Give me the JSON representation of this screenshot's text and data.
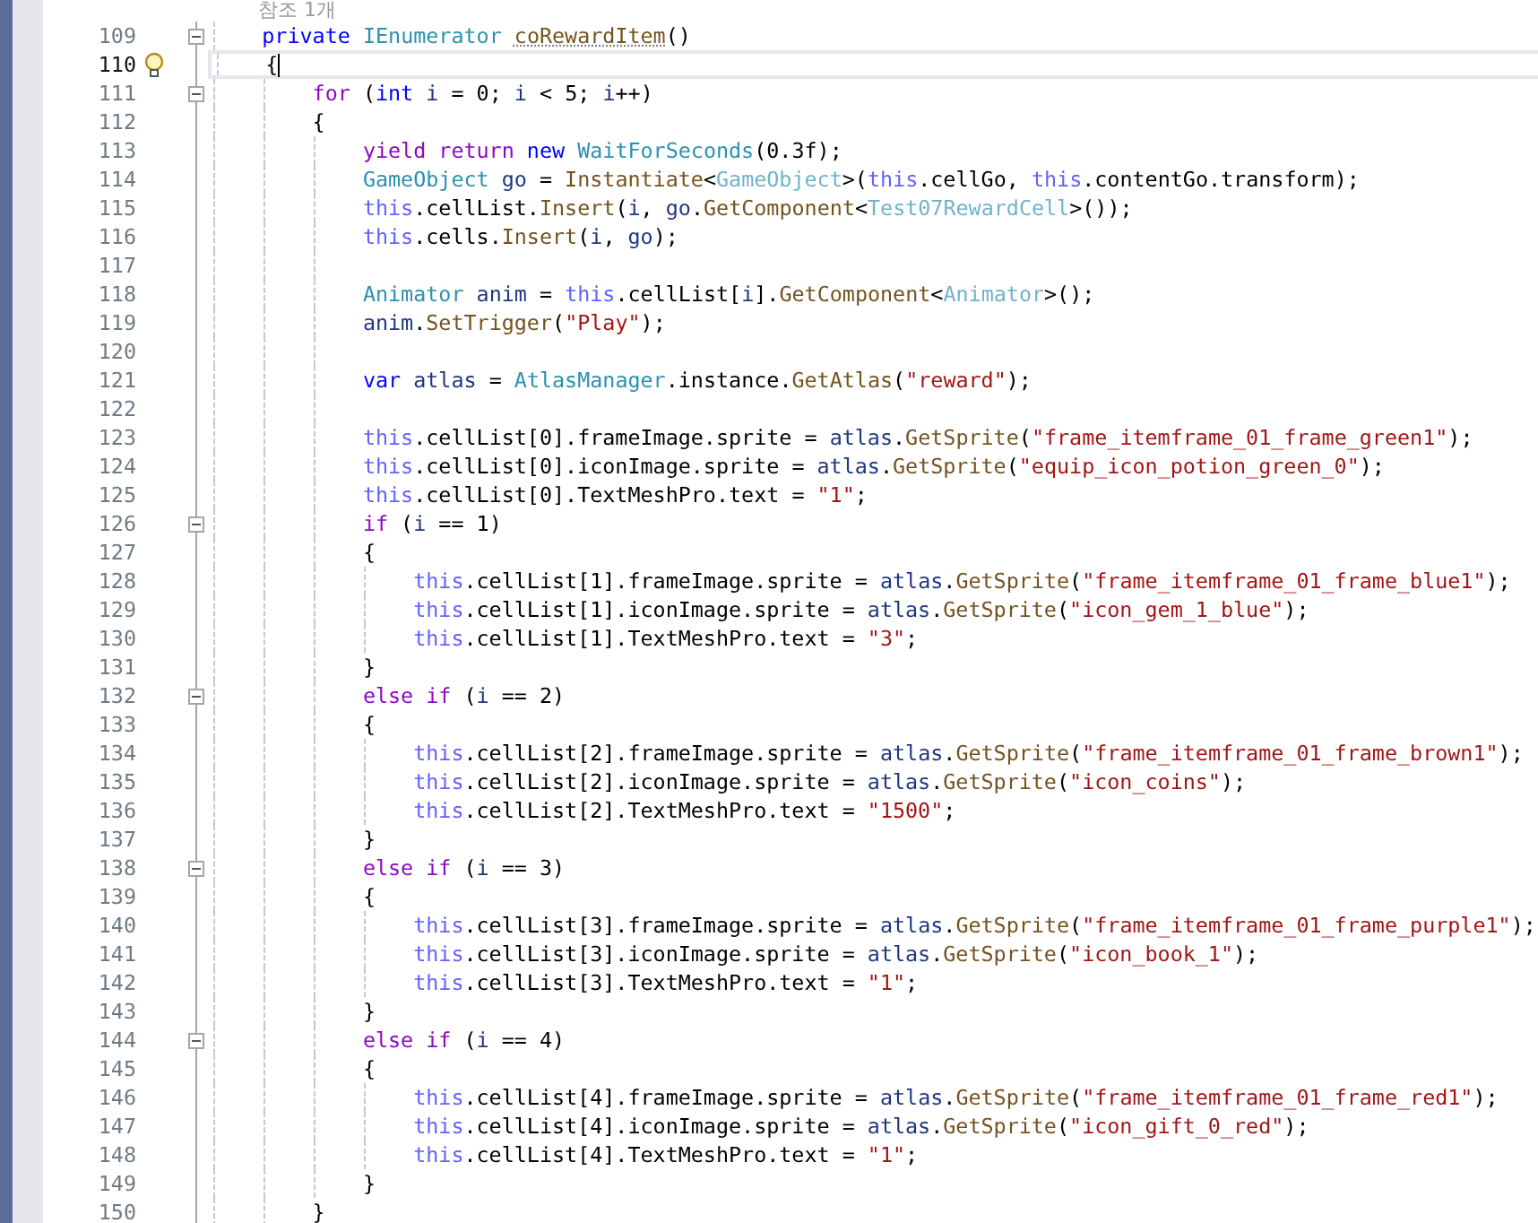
{
  "codelens": "참조 1개",
  "lines": [
    {
      "number": "109",
      "current": false,
      "expanded": true,
      "tokens": [
        {
          "kind": "kw",
          "text": "    private "
        },
        {
          "kind": "type",
          "text": "IEnumerator "
        },
        {
          "kind": "method",
          "text": "coRewardItem"
        },
        {
          "kind": "plain",
          "text": "()"
        }
      ]
    },
    {
      "number": "110",
      "current": true,
      "tokens": [
        {
          "kind": "plain",
          "text": "    {"
        }
      ]
    },
    {
      "number": "111",
      "current": false,
      "expanded": true,
      "tokens": [
        {
          "kind": "ctrl",
          "text": "        for"
        },
        {
          "kind": "plain",
          "text": " ("
        },
        {
          "kind": "kw",
          "text": "int "
        },
        {
          "kind": "local",
          "text": "i"
        },
        {
          "kind": "plain",
          "text": " = 0; "
        },
        {
          "kind": "local",
          "text": "i"
        },
        {
          "kind": "plain",
          "text": " < 5; "
        },
        {
          "kind": "local",
          "text": "i"
        },
        {
          "kind": "plain",
          "text": "++)"
        }
      ]
    },
    {
      "number": "112",
      "current": false,
      "tokens": [
        {
          "kind": "plain",
          "text": "        {"
        }
      ]
    },
    {
      "number": "113",
      "current": false,
      "tokens": [
        {
          "kind": "ctrl",
          "text": "            yield return "
        },
        {
          "kind": "kw",
          "text": "new "
        },
        {
          "kind": "type",
          "text": "WaitForSeconds"
        },
        {
          "kind": "plain",
          "text": "(0.3f);"
        }
      ]
    },
    {
      "number": "114",
      "current": false,
      "tokens": [
        {
          "kind": "type",
          "text": "            GameObject "
        },
        {
          "kind": "local",
          "text": "go"
        },
        {
          "kind": "plain",
          "text": " = "
        },
        {
          "kind": "method",
          "text": "Instantiate"
        },
        {
          "kind": "plain",
          "text": "<"
        },
        {
          "kind": "gtype",
          "text": "GameObject"
        },
        {
          "kind": "plain",
          "text": ">("
        },
        {
          "kind": "this",
          "text": "this"
        },
        {
          "kind": "plain",
          "text": ".cellGo, "
        },
        {
          "kind": "this",
          "text": "this"
        },
        {
          "kind": "plain",
          "text": ".contentGo.transform);"
        }
      ]
    },
    {
      "number": "115",
      "current": false,
      "tokens": [
        {
          "kind": "this",
          "text": "            this"
        },
        {
          "kind": "plain",
          "text": ".cellList."
        },
        {
          "kind": "method",
          "text": "Insert"
        },
        {
          "kind": "plain",
          "text": "("
        },
        {
          "kind": "local",
          "text": "i"
        },
        {
          "kind": "plain",
          "text": ", "
        },
        {
          "kind": "local",
          "text": "go"
        },
        {
          "kind": "plain",
          "text": "."
        },
        {
          "kind": "method",
          "text": "GetComponent"
        },
        {
          "kind": "plain",
          "text": "<"
        },
        {
          "kind": "gtype",
          "text": "Test07RewardCell"
        },
        {
          "kind": "plain",
          "text": ">());"
        }
      ]
    },
    {
      "number": "116",
      "current": false,
      "tokens": [
        {
          "kind": "this",
          "text": "            this"
        },
        {
          "kind": "plain",
          "text": ".cells."
        },
        {
          "kind": "method",
          "text": "Insert"
        },
        {
          "kind": "plain",
          "text": "("
        },
        {
          "kind": "local",
          "text": "i"
        },
        {
          "kind": "plain",
          "text": ", "
        },
        {
          "kind": "local",
          "text": "go"
        },
        {
          "kind": "plain",
          "text": ");"
        }
      ]
    },
    {
      "number": "117",
      "current": false
    },
    {
      "number": "118",
      "current": false,
      "tokens": [
        {
          "kind": "type",
          "text": "            Animator "
        },
        {
          "kind": "local",
          "text": "anim"
        },
        {
          "kind": "plain",
          "text": " = "
        },
        {
          "kind": "this",
          "text": "this"
        },
        {
          "kind": "plain",
          "text": ".cellList["
        },
        {
          "kind": "local",
          "text": "i"
        },
        {
          "kind": "plain",
          "text": "]."
        },
        {
          "kind": "method",
          "text": "GetComponent"
        },
        {
          "kind": "plain",
          "text": "<"
        },
        {
          "kind": "gtype",
          "text": "Animator"
        },
        {
          "kind": "plain",
          "text": ">();"
        }
      ]
    },
    {
      "number": "119",
      "current": false,
      "tokens": [
        {
          "kind": "local",
          "text": "            anim"
        },
        {
          "kind": "plain",
          "text": "."
        },
        {
          "kind": "method",
          "text": "SetTrigger"
        },
        {
          "kind": "plain",
          "text": "("
        },
        {
          "kind": "str",
          "text": "\"Play\""
        },
        {
          "kind": "plain",
          "text": ");"
        }
      ]
    },
    {
      "number": "120",
      "current": false
    },
    {
      "number": "121",
      "current": false,
      "tokens": [
        {
          "kind": "kw",
          "text": "            var "
        },
        {
          "kind": "local",
          "text": "atlas"
        },
        {
          "kind": "plain",
          "text": " = "
        },
        {
          "kind": "type",
          "text": "AtlasManager"
        },
        {
          "kind": "plain",
          "text": ".instance."
        },
        {
          "kind": "method",
          "text": "GetAtlas"
        },
        {
          "kind": "plain",
          "text": "("
        },
        {
          "kind": "str",
          "text": "\"reward\""
        },
        {
          "kind": "plain",
          "text": ");"
        }
      ]
    },
    {
      "number": "122",
      "current": false
    },
    {
      "number": "123",
      "current": false,
      "tokens": [
        {
          "kind": "this",
          "text": "            this"
        },
        {
          "kind": "plain",
          "text": ".cellList[0].frameImage.sprite = "
        },
        {
          "kind": "local",
          "text": "atlas"
        },
        {
          "kind": "plain",
          "text": "."
        },
        {
          "kind": "method",
          "text": "GetSprite"
        },
        {
          "kind": "plain",
          "text": "("
        },
        {
          "kind": "str",
          "text": "\"frame_itemframe_01_frame_green1\""
        },
        {
          "kind": "plain",
          "text": ");"
        }
      ]
    },
    {
      "number": "124",
      "current": false,
      "tokens": [
        {
          "kind": "this",
          "text": "            this"
        },
        {
          "kind": "plain",
          "text": ".cellList[0].iconImage.sprite = "
        },
        {
          "kind": "local",
          "text": "atlas"
        },
        {
          "kind": "plain",
          "text": "."
        },
        {
          "kind": "method",
          "text": "GetSprite"
        },
        {
          "kind": "plain",
          "text": "("
        },
        {
          "kind": "str",
          "text": "\"equip_icon_potion_green_0\""
        },
        {
          "kind": "plain",
          "text": ");"
        }
      ]
    },
    {
      "number": "125",
      "current": false,
      "tokens": [
        {
          "kind": "this",
          "text": "            this"
        },
        {
          "kind": "plain",
          "text": ".cellList[0].TextMeshPro.text = "
        },
        {
          "kind": "str",
          "text": "\"1\""
        },
        {
          "kind": "plain",
          "text": ";"
        }
      ]
    },
    {
      "number": "126",
      "current": false,
      "expanded": true,
      "tokens": [
        {
          "kind": "ctrl",
          "text": "            if"
        },
        {
          "kind": "plain",
          "text": " ("
        },
        {
          "kind": "local",
          "text": "i"
        },
        {
          "kind": "plain",
          "text": " == 1)"
        }
      ]
    },
    {
      "number": "127",
      "current": false,
      "tokens": [
        {
          "kind": "plain",
          "text": "            {"
        }
      ]
    },
    {
      "number": "128",
      "current": false,
      "tokens": [
        {
          "kind": "this",
          "text": "                this"
        },
        {
          "kind": "plain",
          "text": ".cellList[1].frameImage.sprite = "
        },
        {
          "kind": "local",
          "text": "atlas"
        },
        {
          "kind": "plain",
          "text": "."
        },
        {
          "kind": "method",
          "text": "GetSprite"
        },
        {
          "kind": "plain",
          "text": "("
        },
        {
          "kind": "str",
          "text": "\"frame_itemframe_01_frame_blue1\""
        },
        {
          "kind": "plain",
          "text": ");"
        }
      ]
    },
    {
      "number": "129",
      "current": false,
      "tokens": [
        {
          "kind": "this",
          "text": "                this"
        },
        {
          "kind": "plain",
          "text": ".cellList[1].iconImage.sprite = "
        },
        {
          "kind": "local",
          "text": "atlas"
        },
        {
          "kind": "plain",
          "text": "."
        },
        {
          "kind": "method",
          "text": "GetSprite"
        },
        {
          "kind": "plain",
          "text": "("
        },
        {
          "kind": "str",
          "text": "\"icon_gem_1_blue\""
        },
        {
          "kind": "plain",
          "text": ");"
        }
      ]
    },
    {
      "number": "130",
      "current": false,
      "tokens": [
        {
          "kind": "this",
          "text": "                this"
        },
        {
          "kind": "plain",
          "text": ".cellList[1].TextMeshPro.text = "
        },
        {
          "kind": "str",
          "text": "\"3\""
        },
        {
          "kind": "plain",
          "text": ";"
        }
      ]
    },
    {
      "number": "131",
      "current": false,
      "tokens": [
        {
          "kind": "plain",
          "text": "            }"
        }
      ]
    },
    {
      "number": "132",
      "current": false,
      "expanded": true,
      "tokens": [
        {
          "kind": "ctrl",
          "text": "            else if"
        },
        {
          "kind": "plain",
          "text": " ("
        },
        {
          "kind": "local",
          "text": "i"
        },
        {
          "kind": "plain",
          "text": " == 2)"
        }
      ]
    },
    {
      "number": "133",
      "current": false,
      "tokens": [
        {
          "kind": "plain",
          "text": "            {"
        }
      ]
    },
    {
      "number": "134",
      "current": false,
      "tokens": [
        {
          "kind": "this",
          "text": "                this"
        },
        {
          "kind": "plain",
          "text": ".cellList[2].frameImage.sprite = "
        },
        {
          "kind": "local",
          "text": "atlas"
        },
        {
          "kind": "plain",
          "text": "."
        },
        {
          "kind": "method",
          "text": "GetSprite"
        },
        {
          "kind": "plain",
          "text": "("
        },
        {
          "kind": "str",
          "text": "\"frame_itemframe_01_frame_brown1\""
        },
        {
          "kind": "plain",
          "text": ");"
        }
      ]
    },
    {
      "number": "135",
      "current": false,
      "tokens": [
        {
          "kind": "this",
          "text": "                this"
        },
        {
          "kind": "plain",
          "text": ".cellList[2].iconImage.sprite = "
        },
        {
          "kind": "local",
          "text": "atlas"
        },
        {
          "kind": "plain",
          "text": "."
        },
        {
          "kind": "method",
          "text": "GetSprite"
        },
        {
          "kind": "plain",
          "text": "("
        },
        {
          "kind": "str",
          "text": "\"icon_coins\""
        },
        {
          "kind": "plain",
          "text": ");"
        }
      ]
    },
    {
      "number": "136",
      "current": false,
      "tokens": [
        {
          "kind": "this",
          "text": "                this"
        },
        {
          "kind": "plain",
          "text": ".cellList[2].TextMeshPro.text = "
        },
        {
          "kind": "str",
          "text": "\"1500\""
        },
        {
          "kind": "plain",
          "text": ";"
        }
      ]
    },
    {
      "number": "137",
      "current": false,
      "tokens": [
        {
          "kind": "plain",
          "text": "            }"
        }
      ]
    },
    {
      "number": "138",
      "current": false,
      "expanded": true,
      "tokens": [
        {
          "kind": "ctrl",
          "text": "            else if"
        },
        {
          "kind": "plain",
          "text": " ("
        },
        {
          "kind": "local",
          "text": "i"
        },
        {
          "kind": "plain",
          "text": " == 3)"
        }
      ]
    },
    {
      "number": "139",
      "current": false,
      "tokens": [
        {
          "kind": "plain",
          "text": "            {"
        }
      ]
    },
    {
      "number": "140",
      "current": false,
      "tokens": [
        {
          "kind": "this",
          "text": "                this"
        },
        {
          "kind": "plain",
          "text": ".cellList[3].frameImage.sprite = "
        },
        {
          "kind": "local",
          "text": "atlas"
        },
        {
          "kind": "plain",
          "text": "."
        },
        {
          "kind": "method",
          "text": "GetSprite"
        },
        {
          "kind": "plain",
          "text": "("
        },
        {
          "kind": "str",
          "text": "\"frame_itemframe_01_frame_purple1\""
        },
        {
          "kind": "plain",
          "text": ");"
        }
      ]
    },
    {
      "number": "141",
      "current": false,
      "tokens": [
        {
          "kind": "this",
          "text": "                this"
        },
        {
          "kind": "plain",
          "text": ".cellList[3].iconImage.sprite = "
        },
        {
          "kind": "local",
          "text": "atlas"
        },
        {
          "kind": "plain",
          "text": "."
        },
        {
          "kind": "method",
          "text": "GetSprite"
        },
        {
          "kind": "plain",
          "text": "("
        },
        {
          "kind": "str",
          "text": "\"icon_book_1\""
        },
        {
          "kind": "plain",
          "text": ");"
        }
      ]
    },
    {
      "number": "142",
      "current": false,
      "tokens": [
        {
          "kind": "this",
          "text": "                this"
        },
        {
          "kind": "plain",
          "text": ".cellList[3].TextMeshPro.text = "
        },
        {
          "kind": "str",
          "text": "\"1\""
        },
        {
          "kind": "plain",
          "text": ";"
        }
      ]
    },
    {
      "number": "143",
      "current": false,
      "tokens": [
        {
          "kind": "plain",
          "text": "            }"
        }
      ]
    },
    {
      "number": "144",
      "current": false,
      "expanded": true,
      "tokens": [
        {
          "kind": "ctrl",
          "text": "            else if"
        },
        {
          "kind": "plain",
          "text": " ("
        },
        {
          "kind": "local",
          "text": "i"
        },
        {
          "kind": "plain",
          "text": " == 4)"
        }
      ]
    },
    {
      "number": "145",
      "current": false,
      "tokens": [
        {
          "kind": "plain",
          "text": "            {"
        }
      ]
    },
    {
      "number": "146",
      "current": false,
      "tokens": [
        {
          "kind": "this",
          "text": "                this"
        },
        {
          "kind": "plain",
          "text": ".cellList[4].frameImage.sprite = "
        },
        {
          "kind": "local",
          "text": "atlas"
        },
        {
          "kind": "plain",
          "text": "."
        },
        {
          "kind": "method",
          "text": "GetSprite"
        },
        {
          "kind": "plain",
          "text": "("
        },
        {
          "kind": "str",
          "text": "\"frame_itemframe_01_frame_red1\""
        },
        {
          "kind": "plain",
          "text": ");"
        }
      ]
    },
    {
      "number": "147",
      "current": false,
      "tokens": [
        {
          "kind": "this",
          "text": "                this"
        },
        {
          "kind": "plain",
          "text": ".cellList[4].iconImage.sprite = "
        },
        {
          "kind": "local",
          "text": "atlas"
        },
        {
          "kind": "plain",
          "text": "."
        },
        {
          "kind": "method",
          "text": "GetSprite"
        },
        {
          "kind": "plain",
          "text": "("
        },
        {
          "kind": "str",
          "text": "\"icon_gift_0_red\""
        },
        {
          "kind": "plain",
          "text": ");"
        }
      ]
    },
    {
      "number": "148",
      "current": false,
      "tokens": [
        {
          "kind": "this",
          "text": "                this"
        },
        {
          "kind": "plain",
          "text": ".cellList[4].TextMeshPro.text = "
        },
        {
          "kind": "str",
          "text": "\"1\""
        },
        {
          "kind": "plain",
          "text": ";"
        }
      ]
    },
    {
      "number": "149",
      "current": false,
      "tokens": [
        {
          "kind": "plain",
          "text": "            }"
        }
      ]
    },
    {
      "number": "150",
      "current": false,
      "tokens": [
        {
          "kind": "plain",
          "text": "        }"
        }
      ]
    }
  ]
}
